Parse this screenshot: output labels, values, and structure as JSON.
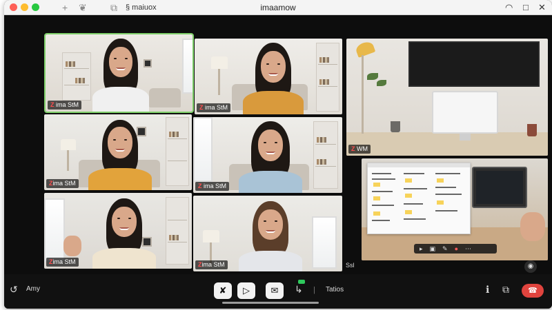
{
  "window": {
    "tab_label": "§ maiuox",
    "title": "imaamow",
    "minimize_glyph": "—",
    "maximize_glyph": "□",
    "close_glyph": "✕",
    "wifi_glyph": "◠"
  },
  "toolbar_icons": {
    "new_tab": "+",
    "extensions": "❦",
    "sidebar": "⧉"
  },
  "participants": [
    {
      "name_prefix": "Z",
      "name": " ima StM",
      "active": true,
      "shirt": "#f0f0f0"
    },
    {
      "name_prefix": "Z",
      "name": " ima StM",
      "active": false,
      "shirt": "#d99a3c"
    },
    {
      "name_prefix": "Z",
      "name": " WM",
      "active": false
    },
    {
      "name_prefix": "Z",
      "name": "ima StM",
      "active": false,
      "shirt": "#e2a33b"
    },
    {
      "name_prefix": "Z",
      "name": " ima StM",
      "active": false,
      "shirt": "#a9c3d6"
    },
    {
      "name_prefix": "",
      "name": "",
      "active": false
    },
    {
      "name_prefix": "Z",
      "name": "ima StM",
      "active": false,
      "shirt": "#efe4cf"
    },
    {
      "name_prefix": "Z",
      "name": "ima StM",
      "active": false,
      "shirt": "#e4e6ea"
    },
    {
      "name_prefix": "",
      "name": "Ssl",
      "active": false
    }
  ],
  "controls": {
    "left_icon": "↺",
    "left_label": "Amy",
    "mute_glyph": "✘",
    "video_glyph": "▷",
    "share_screen_glyph": "✉",
    "share_glyph": "↳",
    "separator": "|",
    "label": "Tatios",
    "info_glyph": "ℹ",
    "layout_glyph": "⧉",
    "end_glyph": "☎"
  },
  "colors": {
    "active_speaker": "#7fd06a",
    "end_call": "#e0443e",
    "share_badge": "#2ec95c"
  }
}
